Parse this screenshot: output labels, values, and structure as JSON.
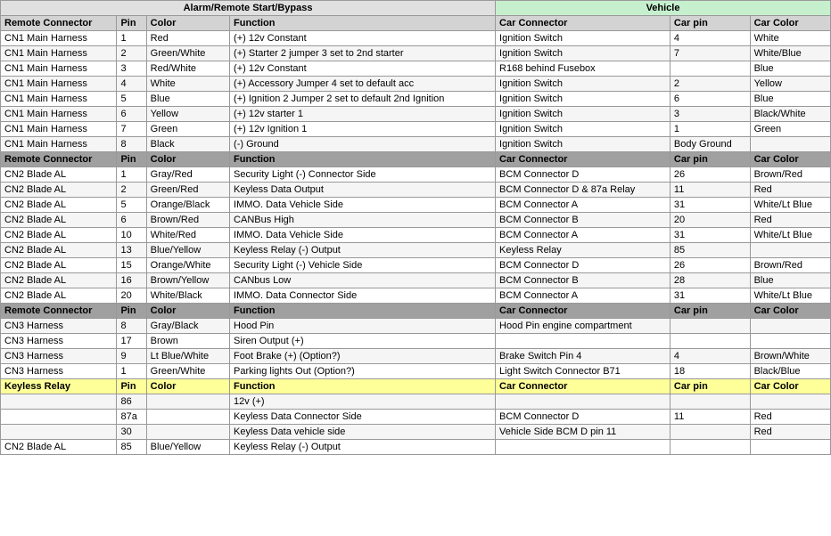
{
  "title": "Alarm/Remote Start/Bypass",
  "vehicle_title": "Vehicle",
  "columns": {
    "alarm": [
      "Remote Connector",
      "Pin",
      "Color",
      "Function"
    ],
    "vehicle": [
      "Car Connector",
      "Car pin",
      "Car Color"
    ]
  },
  "rows": [
    {
      "rc": "CN1 Main Harness",
      "pin": "1",
      "color": "Red",
      "function": "(+) 12v Constant",
      "car_connector": "Ignition Switch",
      "car_pin": "4",
      "car_color": "White"
    },
    {
      "rc": "CN1 Main Harness",
      "pin": "2",
      "color": "Green/White",
      "function": "(+) Starter 2 jumper 3 set to 2nd starter",
      "car_connector": "Ignition Switch",
      "car_pin": "7",
      "car_color": "White/Blue"
    },
    {
      "rc": "CN1 Main Harness",
      "pin": "3",
      "color": "Red/White",
      "function": "(+) 12v Constant",
      "car_connector": "R168 behind Fusebox",
      "car_pin": "",
      "car_color": "Blue"
    },
    {
      "rc": "CN1 Main Harness",
      "pin": "4",
      "color": "White",
      "function": "(+) Accessory Jumper 4 set to default acc",
      "car_connector": "Ignition Switch",
      "car_pin": "2",
      "car_color": "Yellow"
    },
    {
      "rc": "CN1 Main Harness",
      "pin": "5",
      "color": "Blue",
      "function": "(+) Ignition 2 Jumper 2 set to default 2nd Ignition",
      "car_connector": "Ignition Switch",
      "car_pin": "6",
      "car_color": "Blue"
    },
    {
      "rc": "CN1 Main Harness",
      "pin": "6",
      "color": "Yellow",
      "function": "(+) 12v starter 1",
      "car_connector": "Ignition Switch",
      "car_pin": "3",
      "car_color": "Black/White"
    },
    {
      "rc": "CN1 Main Harness",
      "pin": "7",
      "color": "Green",
      "function": "(+) 12v Ignition 1",
      "car_connector": "Ignition Switch",
      "car_pin": "1",
      "car_color": "Green"
    },
    {
      "rc": "CN1 Main Harness",
      "pin": "8",
      "color": "Black",
      "function": "(-) Ground",
      "car_connector": "Ignition Switch",
      "car_pin": "Body Ground",
      "car_color": ""
    },
    {
      "rc": "Remote Connector",
      "pin": "Pin",
      "color": "Color",
      "function": "Function",
      "car_connector": "Car Connector",
      "car_pin": "Car pin",
      "car_color": "Car Color",
      "type": "subheader"
    },
    {
      "rc": "CN2 Blade AL",
      "pin": "1",
      "color": "Gray/Red",
      "function": "Security Light (-) Connector Side",
      "car_connector": "BCM Connector D",
      "car_pin": "26",
      "car_color": "Brown/Red"
    },
    {
      "rc": "CN2 Blade AL",
      "pin": "2",
      "color": "Green/Red",
      "function": "Keyless Data Output",
      "car_connector": "BCM Connector D & 87a Relay",
      "car_pin": "11",
      "car_color": "Red"
    },
    {
      "rc": "CN2 Blade AL",
      "pin": "5",
      "color": "Orange/Black",
      "function": "IMMO. Data Vehicle Side",
      "car_connector": "BCM Connector A",
      "car_pin": "31",
      "car_color": "White/Lt Blue"
    },
    {
      "rc": "CN2 Blade AL",
      "pin": "6",
      "color": "Brown/Red",
      "function": "CANBus High",
      "car_connector": "BCM Connector B",
      "car_pin": "20",
      "car_color": "Red"
    },
    {
      "rc": "CN2 Blade AL",
      "pin": "10",
      "color": "White/Red",
      "function": "IMMO. Data Vehicle Side",
      "car_connector": "BCM Connector A",
      "car_pin": "31",
      "car_color": "White/Lt Blue"
    },
    {
      "rc": "CN2 Blade AL",
      "pin": "13",
      "color": "Blue/Yellow",
      "function": "Keyless Relay (-) Output",
      "car_connector": "Keyless Relay",
      "car_pin": "85",
      "car_color": ""
    },
    {
      "rc": "CN2 Blade AL",
      "pin": "15",
      "color": "Orange/White",
      "function": "Security Light (-) Vehicle Side",
      "car_connector": "BCM Connector D",
      "car_pin": "26",
      "car_color": "Brown/Red"
    },
    {
      "rc": "CN2 Blade AL",
      "pin": "16",
      "color": "Brown/Yellow",
      "function": "CANbus Low",
      "car_connector": "BCM Connector B",
      "car_pin": "28",
      "car_color": "Blue"
    },
    {
      "rc": "CN2 Blade AL",
      "pin": "20",
      "color": "White/Black",
      "function": "IMMO. Data Connector Side",
      "car_connector": "BCM Connector A",
      "car_pin": "31",
      "car_color": "White/Lt Blue"
    },
    {
      "rc": "Remote Connector",
      "pin": "Pin",
      "color": "Color",
      "function": "Function",
      "car_connector": "Car Connector",
      "car_pin": "Car pin",
      "car_color": "Car Color",
      "type": "subheader"
    },
    {
      "rc": "CN3 Harness",
      "pin": "8",
      "color": "Gray/Black",
      "function": "Hood Pin",
      "car_connector": "Hood Pin engine compartment",
      "car_pin": "",
      "car_color": ""
    },
    {
      "rc": "CN3 Harness",
      "pin": "17",
      "color": "Brown",
      "function": "Siren Output  (+)",
      "car_connector": "",
      "car_pin": "",
      "car_color": ""
    },
    {
      "rc": "CN3 Harness",
      "pin": "9",
      "color": "Lt Blue/White",
      "function": "Foot Brake (+) (Option?)",
      "car_connector": "Brake Switch Pin 4",
      "car_pin": "4",
      "car_color": "Brown/White"
    },
    {
      "rc": "CN3 Harness",
      "pin": "1",
      "color": "Green/White",
      "function": "Parking lights Out (Option?)",
      "car_connector": "Light Switch Connector B71",
      "car_pin": "18",
      "car_color": "Black/Blue"
    },
    {
      "rc": "Keyless Relay",
      "pin": "Pin",
      "color": "Color",
      "function": "Function",
      "car_connector": "Car Connector",
      "car_pin": "Car pin",
      "car_color": "Car Color",
      "type": "keyless-header"
    },
    {
      "rc": "",
      "pin": "86",
      "color": "",
      "function": "12v (+)",
      "car_connector": "",
      "car_pin": "",
      "car_color": ""
    },
    {
      "rc": "",
      "pin": "87a",
      "color": "",
      "function": "Keyless Data Connector Side",
      "car_connector": "BCM Connector D",
      "car_pin": "11",
      "car_color": "Red"
    },
    {
      "rc": "",
      "pin": "30",
      "color": "",
      "function": "Keyless Data vehicle side",
      "car_connector": "Vehicle Side BCM D pin 11",
      "car_pin": "",
      "car_color": "Red"
    },
    {
      "rc": "CN2 Blade AL",
      "pin": "85",
      "color": "Blue/Yellow",
      "function": "Keyless Relay (-) Output",
      "car_connector": "",
      "car_pin": "",
      "car_color": ""
    }
  ]
}
